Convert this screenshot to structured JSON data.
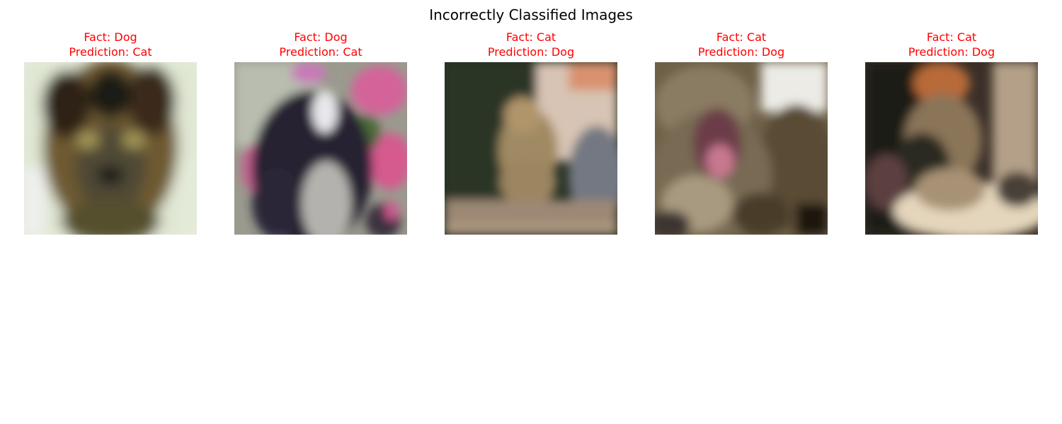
{
  "figure": {
    "title": "Incorrectly Classified Images",
    "title_color": "#000000",
    "label_color": "#ff0000"
  },
  "panels": [
    {
      "fact": "Fact: Dog",
      "prediction": "Prediction: Cat",
      "subject": "dog-face-photo"
    },
    {
      "fact": "Fact: Dog",
      "prediction": "Prediction: Cat",
      "subject": "dog-with-flowers-photo"
    },
    {
      "fact": "Fact: Cat",
      "prediction": "Prediction: Dog",
      "subject": "cat-sitting-photo"
    },
    {
      "fact": "Fact: Cat",
      "prediction": "Prediction: Dog",
      "subject": "cat-yawning-photo"
    },
    {
      "fact": "Fact: Cat",
      "prediction": "Prediction: Dog",
      "subject": "cat-lying-photo"
    }
  ]
}
